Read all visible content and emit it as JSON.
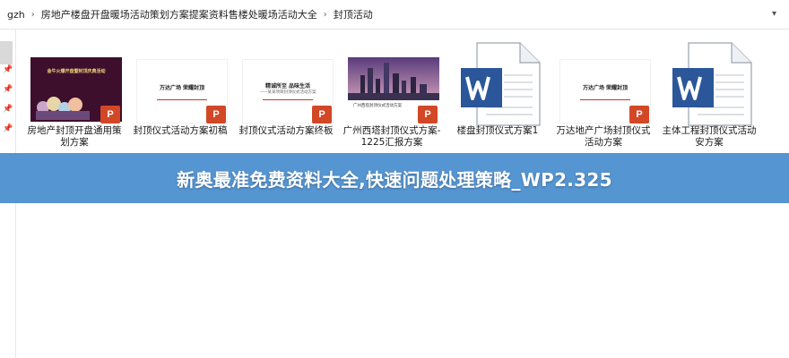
{
  "breadcrumb": {
    "items": [
      "gzh",
      "房地产楼盘开盘暖场活动策划方案提案资料售楼处暖场活动大全",
      "封顶活动"
    ]
  },
  "files": [
    {
      "label": "房地产封顶开盘通用策划方案",
      "type": "ppt-dark",
      "slide_title": "金牛火爆开盘暨封顶庆典活动"
    },
    {
      "label": "封顶仪式活动方案初稿",
      "type": "ppt-white",
      "slide_title": "万达广场 荣耀封顶",
      "slide_sub": ""
    },
    {
      "label": "封顶仪式活动方案终板",
      "type": "ppt-white",
      "slide_title": "精诚所至 品味生活",
      "slide_sub": "——某某项目封顶仪式活动方案"
    },
    {
      "label": "广州西塔封顶仪式方案-1225汇报方案",
      "type": "ppt-city",
      "slide_text": "广州西塔封顶仪式活动方案"
    },
    {
      "label": "楼盘封顶仪式方案1",
      "type": "word"
    },
    {
      "label": "万达地产广场封顶仪式活动方案",
      "type": "ppt-white",
      "slide_title": "万达广场 荣耀封顶",
      "slide_sub": ""
    },
    {
      "label": "主体工程封顶仪式活动安方案",
      "type": "word"
    }
  ],
  "banner": {
    "text": "新奥最准免费资料大全,快速问题处理策略_WP2.325"
  },
  "colors": {
    "banner_bg": "#468ccd",
    "ppt_red": "#d24726",
    "word_blue": "#2b579a"
  }
}
